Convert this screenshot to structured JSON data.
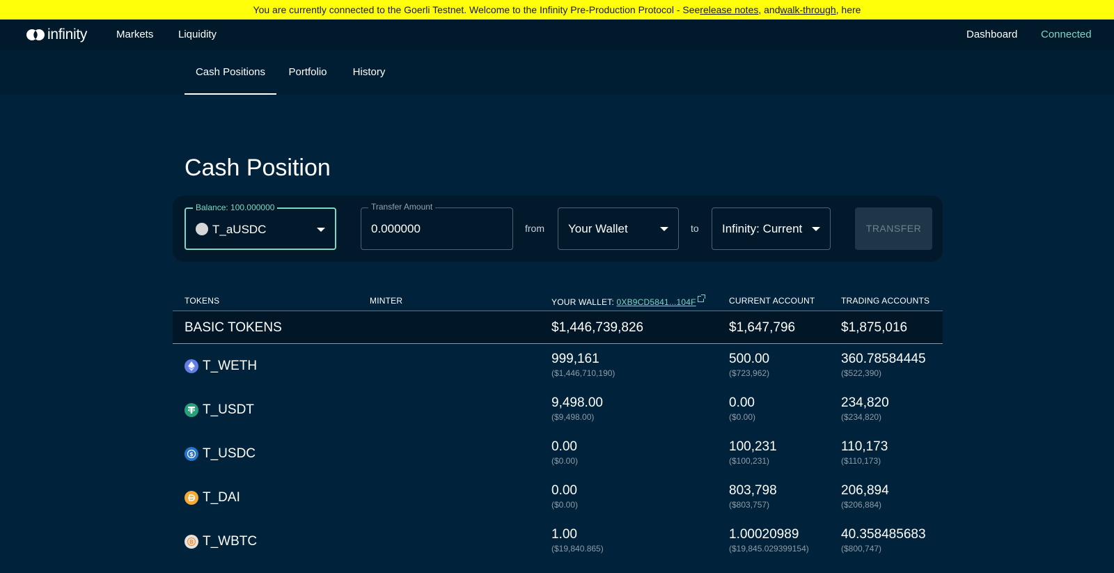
{
  "banner": {
    "text_before": "You are currently connected to the Goerli Testnet. Welcome to the Infinity Pre-Production Protocol - See ",
    "link_release": "release notes",
    "text_mid": ", and ",
    "link_walk": "walk-through",
    "text_after": ", here"
  },
  "nav": {
    "logo": "infinity",
    "markets": "Markets",
    "liquidity": "Liquidity",
    "dashboard": "Dashboard",
    "connected": "Connected"
  },
  "tabs": {
    "cash_positions": "Cash Positions",
    "portfolio": "Portfolio",
    "history": "History"
  },
  "page_title": "Cash Position",
  "transfer": {
    "balance_legend": "Balance: 100.000000",
    "token": "T_aUSDC",
    "amount_legend": "Transfer Amount",
    "amount": "0.000000",
    "from_label": "from",
    "from_value": "Your Wallet",
    "to_label": "to",
    "to_value": "Infinity: Current",
    "button": "TRANSFER"
  },
  "table": {
    "headers": {
      "tokens": "TOKENS",
      "minter": "MINTER",
      "wallet_prefix": "YOUR WALLET: ",
      "wallet_address": "0XB9CD5841...104F",
      "current": "CURRENT ACCOUNT",
      "trading": "TRADING ACCOUNTS"
    },
    "group": {
      "name": "BASIC TOKENS",
      "wallet": "$1,446,739,826",
      "current": "$1,647,796",
      "trading": "$1,875,016"
    },
    "rows": [
      {
        "token": "T_WETH",
        "icon": "ethereum-icon",
        "color": "#627eea",
        "wallet": "999,161",
        "wallet_usd": "($1,446,710,190)",
        "current": "500.00",
        "current_usd": "($723,962)",
        "trading": "360.78584445",
        "trading_usd": "($522,390)"
      },
      {
        "token": "T_USDT",
        "icon": "tether-icon",
        "color": "#26a17b",
        "wallet": "9,498.00",
        "wallet_usd": "($9,498.00)",
        "current": "0.00",
        "current_usd": "($0.00)",
        "trading": "234,820",
        "trading_usd": "($234,820)"
      },
      {
        "token": "T_USDC",
        "icon": "usdc-icon",
        "color": "#2775ca",
        "wallet": "0.00",
        "wallet_usd": "($0.00)",
        "current": "100,231",
        "current_usd": "($100,231)",
        "trading": "110,173",
        "trading_usd": "($110,173)"
      },
      {
        "token": "T_DAI",
        "icon": "dai-icon",
        "color": "#f5ac37",
        "wallet": "0.00",
        "wallet_usd": "($0.00)",
        "current": "803,798",
        "current_usd": "($803,757)",
        "trading": "206,894",
        "trading_usd": "($206,884)"
      },
      {
        "token": "T_WBTC",
        "icon": "wbtc-icon",
        "color": "#e8e2dc",
        "wallet": "1.00",
        "wallet_usd": "($19,840.865)",
        "current": "1.00020989",
        "current_usd": "($19,845.029399154)",
        "trading": "40.358485683",
        "trading_usd": "($800,747)"
      }
    ]
  },
  "colors": {
    "background": "#00223a",
    "banner": "#ffff0a",
    "accent": "#7fd6c2"
  }
}
